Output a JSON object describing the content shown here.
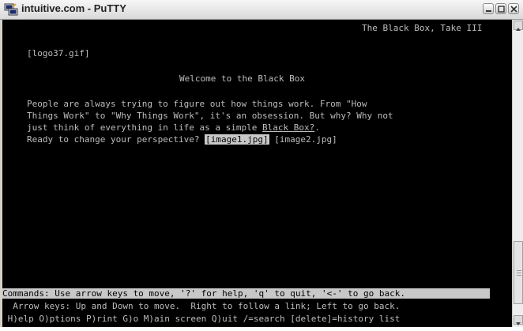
{
  "window": {
    "title": "intuitive.com - PuTTY",
    "icon": "putty-icon",
    "controls": [
      "minimize-icon",
      "maximize-icon",
      "close-icon"
    ]
  },
  "terminal": {
    "header_title": "The Black Box, Take III",
    "logo_link": "[logo37.gif]",
    "welcome": "Welcome to the Black Box",
    "paragraph": {
      "line1": "People are always trying to figure out how things work. From \"How",
      "line2": "Things Work\" to \"Why Things Work\", it's an obsession. But why? Why not",
      "line3_prefix": "just think of everything in life as a simple ",
      "black_box_link": "Black Box?",
      "line3_suffix": ".",
      "line4_prefix": "Ready to change your perspective? ",
      "image1_link": "[image1.jpg]",
      "image2_link": "[image2.jpg]"
    },
    "status_line": "Commands: Use arrow keys to move, '?' for help, 'q' to quit, '<-' to go back.",
    "help_line1": "  Arrow keys: Up and Down to move.  Right to follow a link; Left to go back.",
    "help_line2": " H)elp O)ptions P)rint G)o M)ain screen Q)uit /=search [delete]=history list"
  },
  "colors": {
    "terminal_bg": "#000000",
    "terminal_fg": "#bdbdbd",
    "highlight_bg": "#c8c8c8"
  }
}
